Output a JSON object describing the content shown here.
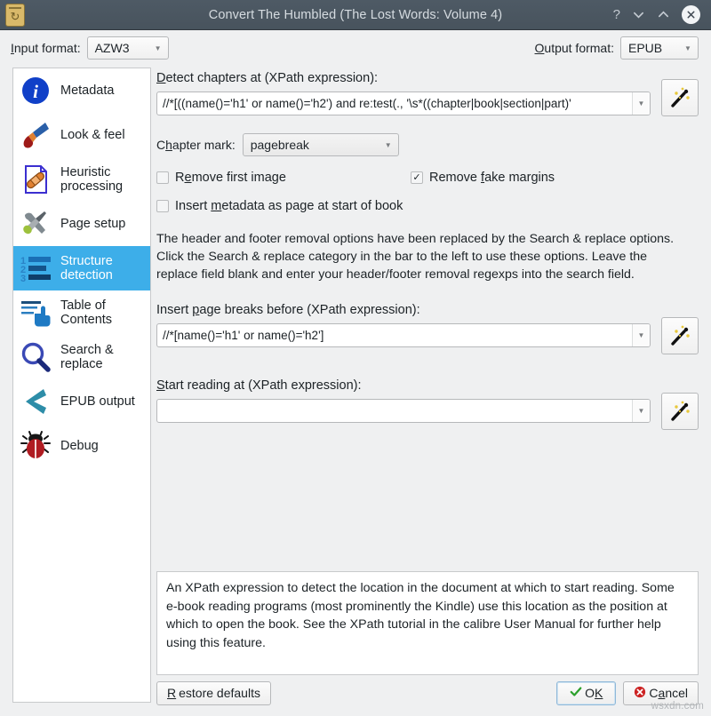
{
  "window": {
    "title": "Convert The Humbled (The Lost Words: Volume 4)",
    "app_icon": "convert-book-icon",
    "help_btn": "?",
    "minimize_btn": "chevron-down-icon",
    "maximize_btn": "chevron-up-icon",
    "close_btn": "close-circle-icon"
  },
  "formats": {
    "input_label_pre": "I",
    "input_label_post": "nput format:",
    "input_value": "AZW3",
    "output_label_pre": "O",
    "output_label_post": "utput format:",
    "output_value": "EPUB"
  },
  "sidebar": {
    "items": [
      {
        "label": "Metadata",
        "icon": "info-circle-icon",
        "selected": false
      },
      {
        "label": "Look & feel",
        "icon": "paintbrush-icon",
        "selected": false
      },
      {
        "label": "Heuristic processing",
        "icon": "document-bandage-icon",
        "selected": false
      },
      {
        "label": "Page setup",
        "icon": "wrench-screwdriver-icon",
        "selected": false
      },
      {
        "label": "Structure detection",
        "icon": "numbered-list-icon",
        "selected": true
      },
      {
        "label": "Table of Contents",
        "icon": "toc-hand-icon",
        "selected": false
      },
      {
        "label": "Search & replace",
        "icon": "magnifier-icon",
        "selected": false
      },
      {
        "label": "EPUB output",
        "icon": "chevron-left-icon",
        "selected": false
      },
      {
        "label": "Debug",
        "icon": "bug-icon",
        "selected": false
      }
    ]
  },
  "main": {
    "detect_chapters": {
      "label_pre": "D",
      "label_post": "etect chapters at (XPath expression):",
      "value": "//*[((name()='h1' or name()='h2') and re:test(., '\\s*((chapter|book|section|part)'",
      "wand": "magic-wand-icon"
    },
    "chapter_mark": {
      "label_pre": "C",
      "label_mid": "h",
      "label_post": "apter mark:",
      "value": "pagebreak"
    },
    "remove_first_image": {
      "label_pre": "R",
      "label_mid": "e",
      "label_post": "move first image",
      "checked": false
    },
    "remove_fake_margins": {
      "label_pre": "Remove ",
      "label_mid": "f",
      "label_post": "ake margins",
      "checked": true,
      "check_glyph": "✓"
    },
    "insert_metadata": {
      "label_pre": "Insert ",
      "label_mid": "m",
      "label_post": "etadata as page at start of book",
      "checked": false
    },
    "description": "The header and footer removal options have been replaced by the Search & replace options. Click the Search & replace category in the bar to the left to use these options. Leave the replace field blank and enter your header/footer removal regexps into the search field.",
    "page_breaks": {
      "label_pre": "Insert ",
      "label_mid": "p",
      "label_post": "age breaks before (XPath expression):",
      "value": "//*[name()='h1' or name()='h2']",
      "wand": "magic-wand-icon"
    },
    "start_reading": {
      "label_pre": "S",
      "label_post": "tart reading at (XPath expression):",
      "value": "",
      "wand": "magic-wand-icon"
    }
  },
  "help_text": "An XPath expression to detect the location in the document at which to start reading. Some e-book reading programs (most prominently the Kindle) use this location as the position at which to open the book. See the XPath tutorial in the calibre User Manual for further help using this feature.",
  "buttons": {
    "restore_pre": "R",
    "restore_post": "estore defaults",
    "ok_pre": "O",
    "ok_mid": "K",
    "ok_icon": "check-icon",
    "cancel_pre": "C",
    "cancel_mid": "a",
    "cancel_post": "ncel",
    "cancel_icon": "error-circle-icon"
  },
  "watermark": "wsxdn.com",
  "colors": {
    "titlebar": "#4b5660",
    "selection": "#3daee9",
    "window_bg": "#eff0f1",
    "ok_green": "#2ca02c",
    "cancel_red": "#cc2222"
  }
}
